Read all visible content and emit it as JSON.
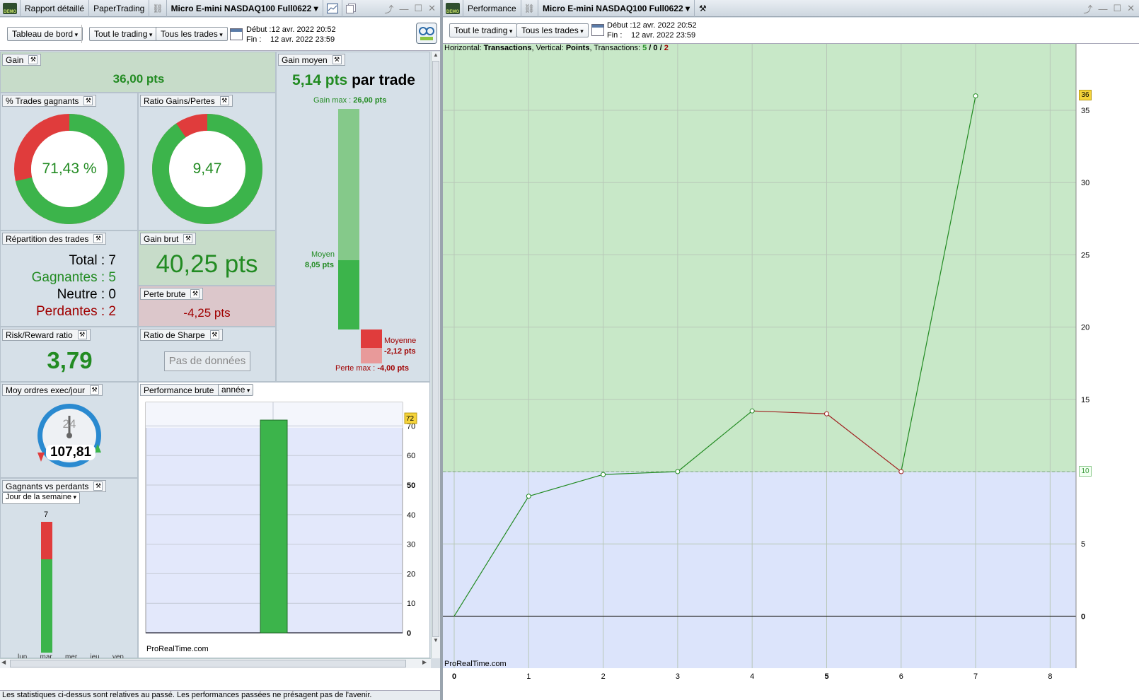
{
  "left_window": {
    "tabs": [
      "Rapport détaillé",
      "PaperTrading",
      "Micro E-mini NASDAQ100 Full0622"
    ],
    "toolbar": {
      "dashboard": "Tableau de bord",
      "trading": "Tout le trading",
      "trades": "Tous les trades",
      "start_label": "Début :",
      "start": "12 avr. 2022 20:52",
      "end_label": "Fin :",
      "end": "12 avr. 2022 23:59"
    },
    "gain": {
      "label": "Gain",
      "value": "36,00 pts"
    },
    "win_pct": {
      "label": "% Trades gagnants",
      "value": "71,43 %",
      "fraction": 0.7143
    },
    "ratio_gl": {
      "label": "Ratio Gains/Pertes",
      "value": "9,47",
      "fraction": 0.9045
    },
    "avg_gain": {
      "label": "Gain moyen",
      "value": "5,14 pts",
      "suffix": "par trade",
      "max_label": "Gain max :",
      "max_value": "26,00 pts",
      "mean_label": "Moyen",
      "mean_value": "8,05 pts",
      "loss_mean_label": "Moyenne",
      "loss_mean_value": "-2,12 pts",
      "loss_max_label": "Perte max :",
      "loss_max_value": "-4,00 pts"
    },
    "distribution": {
      "label": "Répartition des trades",
      "total": "Total : 7",
      "winners": "Gagnantes : 5",
      "neutral": "Neutre : 0",
      "losers": "Perdantes : 2"
    },
    "gross_gain": {
      "label": "Gain brut",
      "value": "40,25 pts"
    },
    "gross_loss": {
      "label": "Perte brute",
      "value": "-4,25 pts"
    },
    "risk_reward": {
      "label": "Risk/Reward ratio",
      "value": "3,79"
    },
    "sharpe": {
      "label": "Ratio de Sharpe",
      "value": "Pas de données"
    },
    "avg_orders": {
      "label": "Moy ordres exec/jour",
      "value": "107,81",
      "dial": "24"
    },
    "gross_perf": {
      "label": "Performance brute",
      "period": "année",
      "badge": "72",
      "watermark": "ProRealTime.com"
    },
    "winners_losers": {
      "label": "Gagnants vs perdants",
      "period": "Jour de la semaine",
      "count": "7",
      "days": [
        "lun",
        "mar",
        "mer",
        "jeu",
        "ven"
      ]
    },
    "status": "Les statistiques ci-dessus sont relatives au passé. Les performances passées ne présagent pas de l'avenir."
  },
  "right_window": {
    "tabs": [
      "Performance",
      "Micro E-mini NASDAQ100 Full0622"
    ],
    "toolbar": {
      "trading": "Tout le trading",
      "trades": "Tous les trades",
      "start_label": "Début :",
      "start": "12 avr. 2022 20:52",
      "end_label": "Fin :",
      "end": "12 avr. 2022 23:59"
    },
    "info": {
      "h_label": "Horizontal:",
      "h_value": "Transactions",
      "v_label": "Vertical:",
      "v_value": "Points",
      "t_label": "Transactions:",
      "wins": "5",
      "sep1": "/",
      "neutral": "0",
      "sep2": "/",
      "losses": "2"
    },
    "watermark": "ProRealTime.com",
    "badge_last": "36",
    "badge_ref": "10"
  },
  "chart_data": [
    {
      "type": "line",
      "title": "",
      "xlabel": "Transactions",
      "ylabel": "Points",
      "x": [
        0,
        1,
        2,
        3,
        4,
        5,
        6,
        7
      ],
      "y": [
        0,
        8.3,
        9.8,
        10,
        14.2,
        14,
        10,
        36
      ],
      "segment_colors": [
        "#228b22",
        "#228b22",
        "#228b22",
        "#228b22",
        "#a02020",
        "#a02020",
        "#228b22"
      ],
      "xlim": [
        0,
        8.5
      ],
      "ylim": [
        -3.6,
        39.6
      ],
      "x_ticks": [
        "0",
        "1",
        "2",
        "3",
        "4",
        "5",
        "6",
        "7",
        "8"
      ],
      "y_ticks": [
        "0",
        "5",
        "10",
        "15",
        "20",
        "25",
        "30",
        "35"
      ],
      "reference_y": 10,
      "grid": true
    },
    {
      "type": "bar",
      "title": "",
      "categories": [
        ""
      ],
      "values": [
        72
      ],
      "ylim": [
        0,
        78
      ],
      "y_ticks": [
        "0",
        "10",
        "20",
        "30",
        "40",
        "50",
        "60",
        "70"
      ],
      "grid": true
    },
    {
      "type": "bar",
      "title": "",
      "categories": [
        ""
      ],
      "series": [
        {
          "values": [
            5
          ]
        },
        {
          "values": [
            2
          ]
        }
      ],
      "ylim": [
        0,
        7
      ]
    }
  ],
  "colors": {
    "green": "#3cb44b",
    "red": "#e03c3c",
    "dark_green": "#228b22",
    "dark_red": "#a00000"
  }
}
